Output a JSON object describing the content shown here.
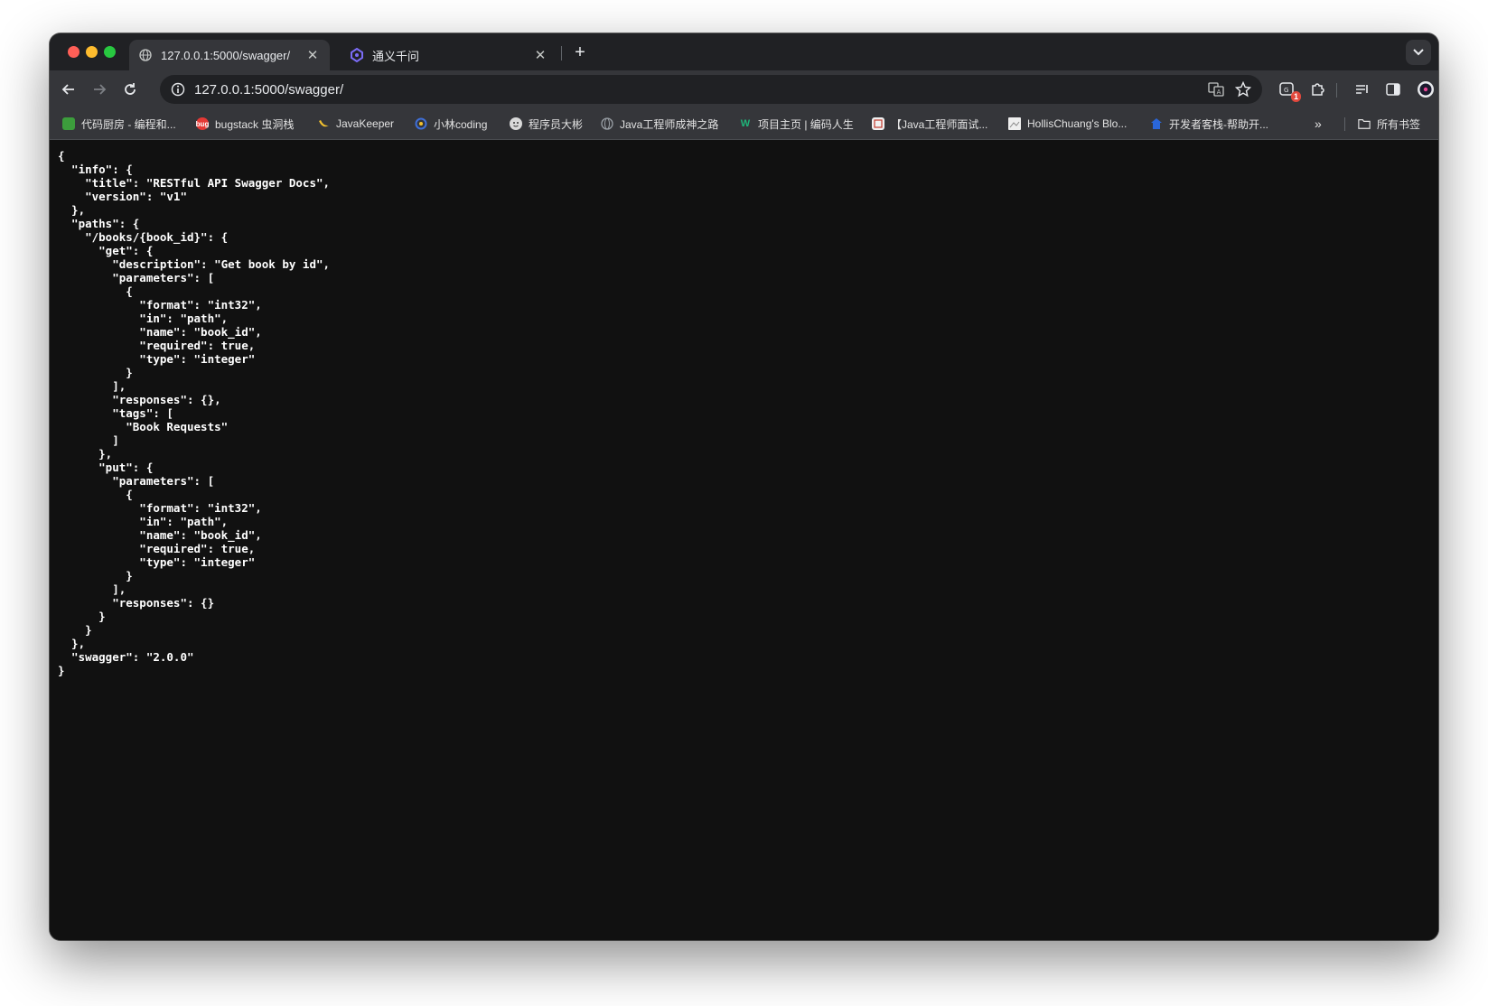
{
  "browser": {
    "tabs": [
      {
        "title": "127.0.0.1:5000/swagger/",
        "active": true
      },
      {
        "title": "通义千问",
        "active": false
      }
    ],
    "new_tab_label": "+",
    "close_glyph": "✕",
    "address_bar": {
      "url": "127.0.0.1:5000/swagger/"
    },
    "extension_badge": "1",
    "bookmarks": [
      {
        "label": "代码厨房 - 编程和...",
        "icon": "green-grid-icon",
        "color": "#3c9d3c"
      },
      {
        "label": "bugstack 虫洞栈",
        "icon": "bugstack-icon",
        "color": "#e53935"
      },
      {
        "label": "JavaKeeper",
        "icon": "banana-icon",
        "color": "#f2c12e"
      },
      {
        "label": "小林coding",
        "icon": "xiaolin-icon",
        "color": "#3f6fd8"
      },
      {
        "label": "程序员大彬",
        "icon": "face-icon",
        "color": "#d9d9d9"
      },
      {
        "label": "Java工程师成神之路",
        "icon": "globe-icon",
        "color": "#9aa0a6"
      },
      {
        "label": "项目主页 | 编码人生",
        "icon": "w-logo-icon",
        "color": "#1fb57a"
      },
      {
        "label": "【Java工程师面试...",
        "icon": "doc-icon",
        "color": "#f1f1f1"
      },
      {
        "label": "HollisChuang's Blo...",
        "icon": "image-icon",
        "color": "#eeeeee"
      },
      {
        "label": "开发者客栈-帮助开...",
        "icon": "house-icon",
        "color": "#2a66d8"
      }
    ],
    "more_bookmarks": "»",
    "all_bookmarks_label": "所有书签"
  },
  "page": {
    "json_text": "{\n  \"info\": {\n    \"title\": \"RESTful API Swagger Docs\",\n    \"version\": \"v1\"\n  },\n  \"paths\": {\n    \"/books/{book_id}\": {\n      \"get\": {\n        \"description\": \"Get book by id\",\n        \"parameters\": [\n          {\n            \"format\": \"int32\",\n            \"in\": \"path\",\n            \"name\": \"book_id\",\n            \"required\": true,\n            \"type\": \"integer\"\n          }\n        ],\n        \"responses\": {},\n        \"tags\": [\n          \"Book Requests\"\n        ]\n      },\n      \"put\": {\n        \"parameters\": [\n          {\n            \"format\": \"int32\",\n            \"in\": \"path\",\n            \"name\": \"book_id\",\n            \"required\": true,\n            \"type\": \"integer\"\n          }\n        ],\n        \"responses\": {}\n      }\n    }\n  },\n  \"swagger\": \"2.0.0\"\n}"
  },
  "colors": {
    "content_background": "#111111",
    "toolbar": "#35363a",
    "tabstrip": "#202124"
  }
}
